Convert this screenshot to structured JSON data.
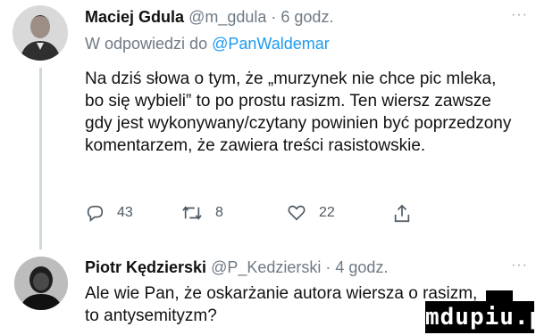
{
  "tweet1": {
    "name": "Maciej Gdula",
    "handle": "@m_gdula",
    "time": "· 6 godz.",
    "more": "···",
    "reply_prefix": "W odpowiedzi do",
    "reply_handle": "@PanWaldemar",
    "text": "Na dziś słowa o tym, że „murzynek nie chce pic mleka, bo się wybieli” to po prostu rasizm. Ten wiersz zawsze gdy jest wykonywany/czytany powinien być poprzedzony komentarzem, że zawiera treści rasistowskie.",
    "actions": {
      "reply_count": "43",
      "retweet_count": "8",
      "like_count": "22"
    }
  },
  "tweet2": {
    "name": "Piotr Kędzierski",
    "handle": "@P_Kedzierski",
    "time": "· 4 godz.",
    "more": "···",
    "text": "Ale wie Pan, że oskarżanie autora wiersza o rasizm, to antysemityzm?"
  },
  "watermark": "mdupiu.pl",
  "colors": {
    "text": "#111111",
    "muted": "#6e7a85",
    "link": "#1d9bf0",
    "thread_line": "#cfd9de"
  }
}
